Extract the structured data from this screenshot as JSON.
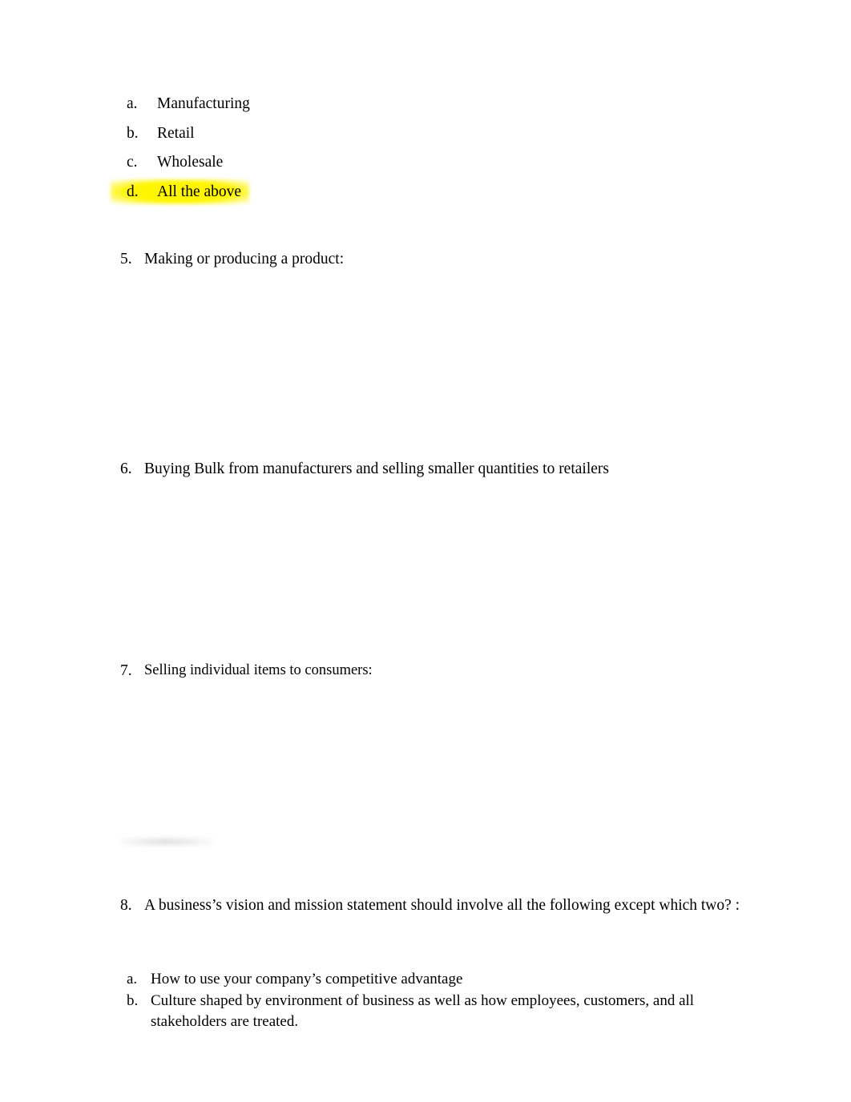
{
  "document": {
    "choices_top": [
      {
        "marker": "a.",
        "text": "Manufacturing",
        "highlighted": false
      },
      {
        "marker": "b.",
        "text": "Retail",
        "highlighted": false
      },
      {
        "marker": "c.",
        "text": "Wholesale",
        "highlighted": false
      },
      {
        "marker": "d.",
        "text": "All the above",
        "highlighted": true
      }
    ],
    "questions": [
      {
        "number": "5.",
        "text": "Making or producing a product:"
      },
      {
        "number": "6.",
        "text": "Buying Bulk from manufacturers and selling smaller quantities to retailers"
      },
      {
        "number": "7.",
        "text": "Selling individual items to consumers:"
      },
      {
        "number": "8.",
        "text": "A business’s vision and mission statement should involve all the following except which two? :"
      }
    ],
    "choices_bottom": [
      {
        "marker": "a.",
        "text": "How to use your company’s competitive advantage"
      },
      {
        "marker": "b.",
        "text": "Culture shaped by environment of business as well as how employees, customers, and all stakeholders are treated."
      }
    ],
    "colors": {
      "highlight": "#fff500",
      "text": "#000000",
      "background": "#ffffff"
    }
  }
}
